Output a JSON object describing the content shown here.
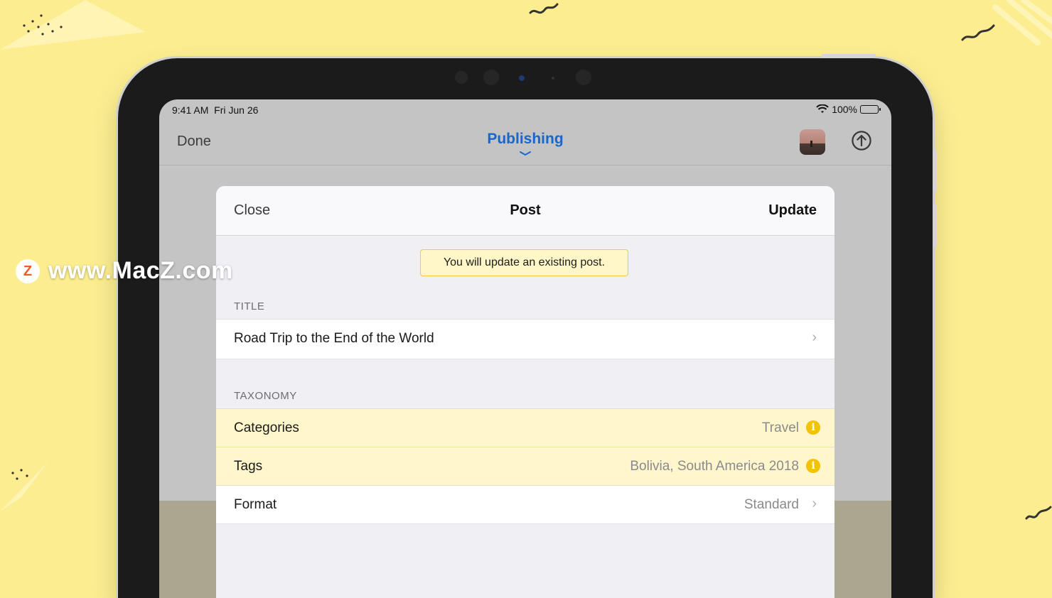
{
  "status_bar": {
    "time": "9:41 AM",
    "date": "Fri Jun 26",
    "battery": "100%"
  },
  "nav": {
    "done_label": "Done",
    "title": "Publishing"
  },
  "sheet": {
    "close_label": "Close",
    "title": "Post",
    "update_label": "Update",
    "notice": "You will update an existing post.",
    "title_section": {
      "header": "TITLE",
      "value": "Road Trip to the End of the World"
    },
    "taxonomy_section": {
      "header": "TAXONOMY",
      "rows": [
        {
          "label": "Categories",
          "value": "Travel"
        },
        {
          "label": "Tags",
          "value": "Bolivia, South America 2018"
        },
        {
          "label": "Format",
          "value": "Standard"
        }
      ]
    }
  },
  "watermark": {
    "logo_letter": "Z",
    "text": "www.MacZ.com"
  },
  "colors": {
    "background": "#fcee90",
    "accent": "#1a67c9",
    "highlight_row": "#fff6cc",
    "info_icon": "#f2c300"
  }
}
